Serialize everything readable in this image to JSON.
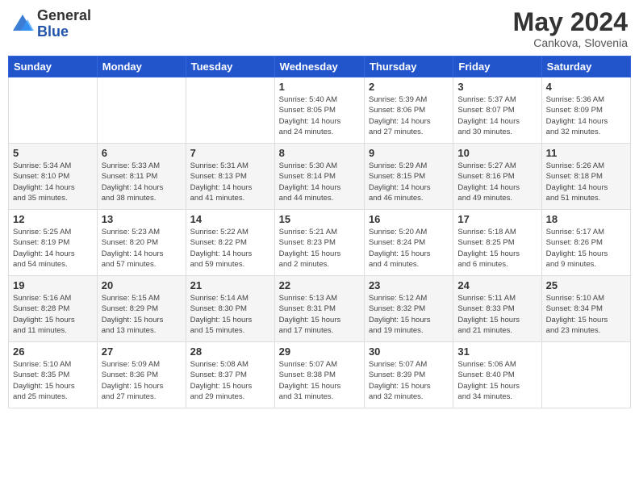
{
  "header": {
    "logo_general": "General",
    "logo_blue": "Blue",
    "month": "May 2024",
    "location": "Cankova, Slovenia"
  },
  "weekdays": [
    "Sunday",
    "Monday",
    "Tuesday",
    "Wednesday",
    "Thursday",
    "Friday",
    "Saturday"
  ],
  "weeks": [
    [
      {
        "day": "",
        "info": ""
      },
      {
        "day": "",
        "info": ""
      },
      {
        "day": "",
        "info": ""
      },
      {
        "day": "1",
        "info": "Sunrise: 5:40 AM\nSunset: 8:05 PM\nDaylight: 14 hours\nand 24 minutes."
      },
      {
        "day": "2",
        "info": "Sunrise: 5:39 AM\nSunset: 8:06 PM\nDaylight: 14 hours\nand 27 minutes."
      },
      {
        "day": "3",
        "info": "Sunrise: 5:37 AM\nSunset: 8:07 PM\nDaylight: 14 hours\nand 30 minutes."
      },
      {
        "day": "4",
        "info": "Sunrise: 5:36 AM\nSunset: 8:09 PM\nDaylight: 14 hours\nand 32 minutes."
      }
    ],
    [
      {
        "day": "5",
        "info": "Sunrise: 5:34 AM\nSunset: 8:10 PM\nDaylight: 14 hours\nand 35 minutes."
      },
      {
        "day": "6",
        "info": "Sunrise: 5:33 AM\nSunset: 8:11 PM\nDaylight: 14 hours\nand 38 minutes."
      },
      {
        "day": "7",
        "info": "Sunrise: 5:31 AM\nSunset: 8:13 PM\nDaylight: 14 hours\nand 41 minutes."
      },
      {
        "day": "8",
        "info": "Sunrise: 5:30 AM\nSunset: 8:14 PM\nDaylight: 14 hours\nand 44 minutes."
      },
      {
        "day": "9",
        "info": "Sunrise: 5:29 AM\nSunset: 8:15 PM\nDaylight: 14 hours\nand 46 minutes."
      },
      {
        "day": "10",
        "info": "Sunrise: 5:27 AM\nSunset: 8:16 PM\nDaylight: 14 hours\nand 49 minutes."
      },
      {
        "day": "11",
        "info": "Sunrise: 5:26 AM\nSunset: 8:18 PM\nDaylight: 14 hours\nand 51 minutes."
      }
    ],
    [
      {
        "day": "12",
        "info": "Sunrise: 5:25 AM\nSunset: 8:19 PM\nDaylight: 14 hours\nand 54 minutes."
      },
      {
        "day": "13",
        "info": "Sunrise: 5:23 AM\nSunset: 8:20 PM\nDaylight: 14 hours\nand 57 minutes."
      },
      {
        "day": "14",
        "info": "Sunrise: 5:22 AM\nSunset: 8:22 PM\nDaylight: 14 hours\nand 59 minutes."
      },
      {
        "day": "15",
        "info": "Sunrise: 5:21 AM\nSunset: 8:23 PM\nDaylight: 15 hours\nand 2 minutes."
      },
      {
        "day": "16",
        "info": "Sunrise: 5:20 AM\nSunset: 8:24 PM\nDaylight: 15 hours\nand 4 minutes."
      },
      {
        "day": "17",
        "info": "Sunrise: 5:18 AM\nSunset: 8:25 PM\nDaylight: 15 hours\nand 6 minutes."
      },
      {
        "day": "18",
        "info": "Sunrise: 5:17 AM\nSunset: 8:26 PM\nDaylight: 15 hours\nand 9 minutes."
      }
    ],
    [
      {
        "day": "19",
        "info": "Sunrise: 5:16 AM\nSunset: 8:28 PM\nDaylight: 15 hours\nand 11 minutes."
      },
      {
        "day": "20",
        "info": "Sunrise: 5:15 AM\nSunset: 8:29 PM\nDaylight: 15 hours\nand 13 minutes."
      },
      {
        "day": "21",
        "info": "Sunrise: 5:14 AM\nSunset: 8:30 PM\nDaylight: 15 hours\nand 15 minutes."
      },
      {
        "day": "22",
        "info": "Sunrise: 5:13 AM\nSunset: 8:31 PM\nDaylight: 15 hours\nand 17 minutes."
      },
      {
        "day": "23",
        "info": "Sunrise: 5:12 AM\nSunset: 8:32 PM\nDaylight: 15 hours\nand 19 minutes."
      },
      {
        "day": "24",
        "info": "Sunrise: 5:11 AM\nSunset: 8:33 PM\nDaylight: 15 hours\nand 21 minutes."
      },
      {
        "day": "25",
        "info": "Sunrise: 5:10 AM\nSunset: 8:34 PM\nDaylight: 15 hours\nand 23 minutes."
      }
    ],
    [
      {
        "day": "26",
        "info": "Sunrise: 5:10 AM\nSunset: 8:35 PM\nDaylight: 15 hours\nand 25 minutes."
      },
      {
        "day": "27",
        "info": "Sunrise: 5:09 AM\nSunset: 8:36 PM\nDaylight: 15 hours\nand 27 minutes."
      },
      {
        "day": "28",
        "info": "Sunrise: 5:08 AM\nSunset: 8:37 PM\nDaylight: 15 hours\nand 29 minutes."
      },
      {
        "day": "29",
        "info": "Sunrise: 5:07 AM\nSunset: 8:38 PM\nDaylight: 15 hours\nand 31 minutes."
      },
      {
        "day": "30",
        "info": "Sunrise: 5:07 AM\nSunset: 8:39 PM\nDaylight: 15 hours\nand 32 minutes."
      },
      {
        "day": "31",
        "info": "Sunrise: 5:06 AM\nSunset: 8:40 PM\nDaylight: 15 hours\nand 34 minutes."
      },
      {
        "day": "",
        "info": ""
      }
    ]
  ]
}
